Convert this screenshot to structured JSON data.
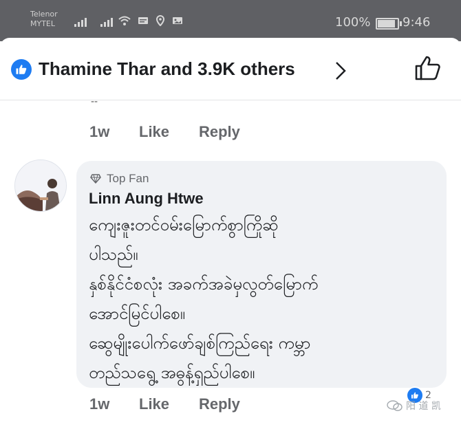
{
  "status_bar": {
    "carrier_top": "Telenor",
    "carrier_bottom": "MYTEL",
    "signal_label": ".ıll",
    "battery_percent": "100%",
    "battery_level": 0.95,
    "time": "9:46",
    "icons": [
      "signal-icon",
      "signal-icon",
      "wifi-icon",
      "message-icon",
      "location-icon",
      "image-icon"
    ]
  },
  "reactions": {
    "summary": "Thamine Thar and 3.9K others",
    "icon": "like-badge-icon"
  },
  "previous_comment": {
    "fragment": "--",
    "time": "1w",
    "like": "Like",
    "reply": "Reply"
  },
  "comment": {
    "badge": "Top Fan",
    "author": "Linn Aung Htwe",
    "text": "ကျေးဇူးတင်ဝမ်းမြောက်စွာကြိုဆို\nပါသည်။\nနှစ်နိုင်ငံစလုံး အခက်အခဲမှလွတ်မြောက်\nအောင်မြင်ပါစေ။\nဆွေမျိုးပေါက်ဖော်ချစ်ကြည်ရေး ကမ္ဘာ\nတည်သရွေ့ အဓွန့်ရှည်ပါစေ။",
    "time": "1w",
    "like": "Like",
    "reply": "Reply",
    "reaction_count": "2"
  },
  "watermark": {
    "text": "阳 道 凯"
  },
  "colors": {
    "status_bar": "#5f6064",
    "facebook_blue": "#1e7cf2",
    "bubble": "#f0f2f5",
    "meta_text": "#65676b"
  }
}
